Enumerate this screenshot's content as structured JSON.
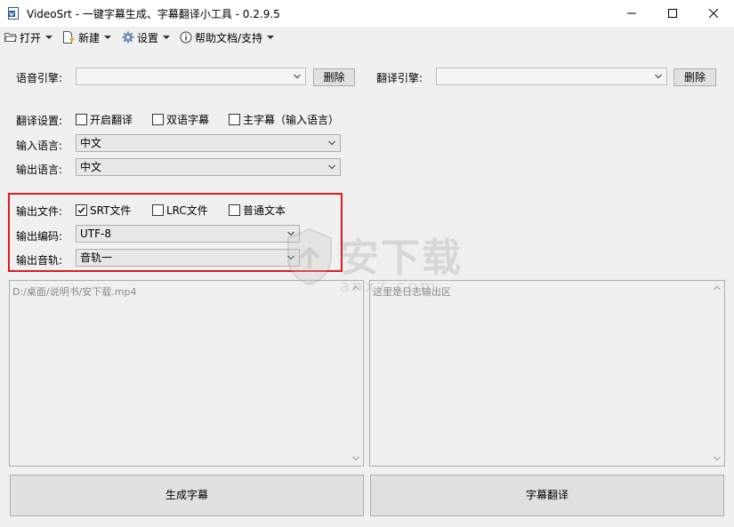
{
  "titlebar": {
    "title": "VideoSrt - 一键字幕生成、字幕翻译小工具 - 0.2.9.5"
  },
  "menu": {
    "open": "打开",
    "new": "新建",
    "settings": "设置",
    "help": "帮助文档/支持"
  },
  "engines": {
    "speech_label": "语音引擎:",
    "speech_value": "",
    "speech_delete": "删除",
    "translate_label": "翻译引擎:",
    "translate_value": "",
    "translate_delete": "删除"
  },
  "translation": {
    "settings_label": "翻译设置:",
    "enable_translation": "开启翻译",
    "bilingual": "双语字幕",
    "main_subtitle": "主字幕（输入语言）",
    "input_lang_label": "输入语言:",
    "input_lang_value": "中文",
    "output_lang_label": "输出语言:",
    "output_lang_value": "中文"
  },
  "output": {
    "file_label": "输出文件:",
    "srt": "SRT文件",
    "srt_checked": true,
    "lrc": "LRC文件",
    "lrc_checked": false,
    "plain": "普通文本",
    "plain_checked": false,
    "encoding_label": "输出编码:",
    "encoding_value": "UTF-8",
    "track_label": "输出音轨:",
    "track_value": "音轨一"
  },
  "panes": {
    "file_path": "D:/桌面/说明书/安下载.mp4",
    "log_placeholder": "这里是日志输出区"
  },
  "actions": {
    "generate": "生成字幕",
    "translate": "字幕翻译"
  },
  "watermark": {
    "text": "安下载",
    "sub": "anxz.com"
  },
  "colors": {
    "highlight_frame": "#e0191e",
    "window_bg": "#f0f0f0"
  }
}
